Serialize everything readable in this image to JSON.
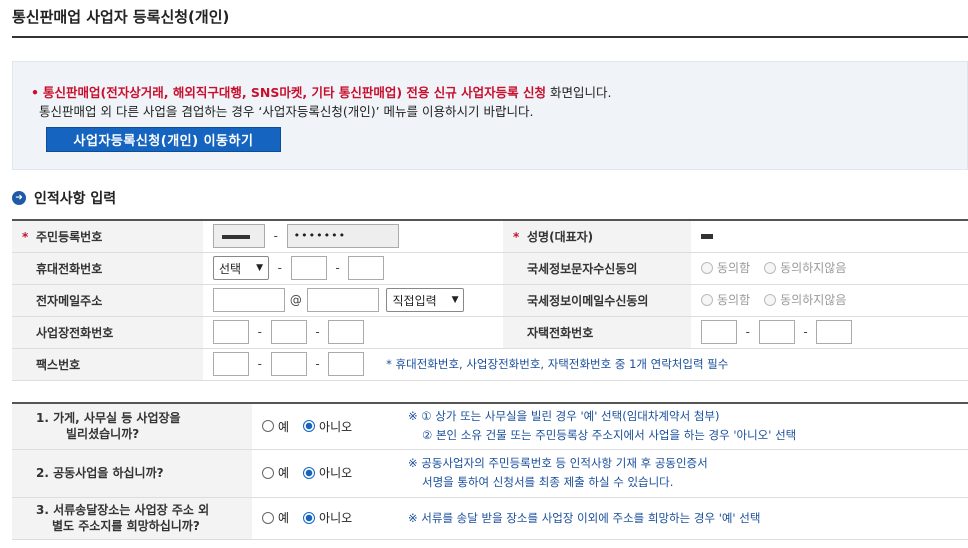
{
  "page": {
    "title": "통신판매업 사업자 등록신청(개인)"
  },
  "notice": {
    "bullet": "•",
    "line1_red": "통신판매업(전자상거래, 해외직구대행, SNS마켓, 기타 통신판매업) 전용 신규 사업자등록 신청",
    "line1_rest": " 화면입니다.",
    "line2": "통신판매업 외 다른 사업을 겸업하는 경우 ‘사업자등록신청(개인)’  메뉴를 이용하시기 바랍니다.",
    "button_label": "사업자등록신청(개인) 이동하기"
  },
  "section": {
    "title": "인적사항 입력"
  },
  "form": {
    "rrn_label": "주민등록번호",
    "rrn_back_masked": "•••••••",
    "name_label": "성명(대표자)",
    "mobile_label": "휴대전화번호",
    "mobile_select": "선택",
    "nts_sms_label": "국세정보문자수신동의",
    "email_label": "전자메일주소",
    "email_at": "@",
    "email_domain_select": "직접입력",
    "nts_email_label": "국세정보이메일수신동의",
    "agree": "동의함",
    "disagree": "동의하지않음",
    "biz_phone_label": "사업장전화번호",
    "home_phone_label": "자택전화번호",
    "fax_label": "팩스번호",
    "contact_note": "* 휴대전화번호, 사업장전화번호, 자택전화번호 중 1개 연락처입력 필수",
    "dash": "-"
  },
  "questions": {
    "yes": "예",
    "no": "아니오",
    "items": [
      {
        "label_line1": "1. 가게, 사무실 등 사업장을",
        "label_line2": "빌리셨습니까?",
        "note_line1": "※ ① 상가 또는 사무실을 빌린 경우 '예' 선택(임대차계약서 첨부)",
        "note_line2": "② 본인 소유 건물 또는 주민등록상 주소지에서 사업을 하는 경우 '아니오' 선택",
        "selected": "no"
      },
      {
        "label_line1": "2. 공동사업을 하십니까?",
        "label_line2": "",
        "note_line1": "※ 공동사업자의 주민등록번호 등 인적사항 기재 후 공동인증서",
        "note_line2": "서명을 통하여 신청서를 최종 제출 하실 수 있습니다.",
        "selected": "no"
      },
      {
        "label_line1": "3. 서류송달장소는 사업장 주소 외",
        "label_line2": "별도 주소지를 희망하십니까?",
        "note_line1": "※ 서류를 송달 받을 장소를 사업장 이외에 주소를 희망하는 경우 '예' 선택",
        "note_line2": "",
        "selected": "no"
      }
    ]
  },
  "colors": {
    "accent_blue": "#1565c0",
    "required_red": "#c8102e",
    "note_blue": "#1a4f9c"
  }
}
